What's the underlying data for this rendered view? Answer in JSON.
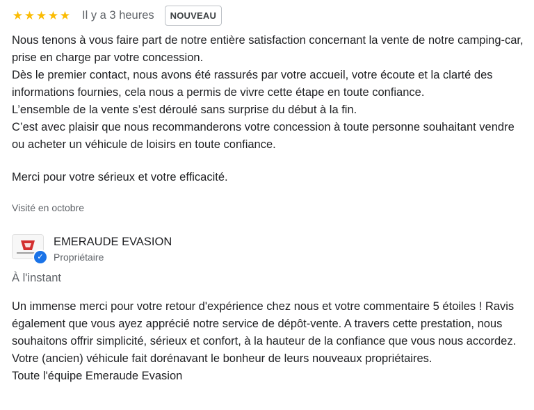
{
  "review": {
    "rating": 5,
    "stars": [
      "★",
      "★",
      "★",
      "★",
      "★"
    ],
    "time_ago": "Il y a 3 heures",
    "badge": "NOUVEAU",
    "lines": [
      "Nous tenons à vous faire part de notre entière satisfaction concernant la vente de notre camping-car, prise en charge par votre concession.",
      "Dès le premier contact, nous avons été rassurés par votre accueil, votre écoute et la clarté des informations fournies, cela nous a permis de vivre cette étape en toute confiance.",
      "L’ensemble de la vente s’est déroulé sans surprise du début à la fin.",
      "C’est avec plaisir que nous recommanderons votre concession à toute personne souhaitant vendre ou acheter un véhicule de loisirs en toute confiance."
    ],
    "thanks": "Merci pour votre sérieux et votre efficacité.",
    "visited": "Visité en octobre"
  },
  "owner": {
    "name": "EMERAUDE EVASION",
    "role": "Propriétaire",
    "avatar_icon": "business-logo-icon",
    "verified_icon": "verified-check-icon",
    "verified_glyph": "✓",
    "reply_time": "À l'instant",
    "reply_text": "Un immense merci pour votre retour d'expérience chez nous et votre commentaire 5 étoiles ! Ravis également que vous ayez apprécié notre service de dépôt-vente. A travers cette prestation, nous souhaitons offrir simplicité, sérieux et confort, à la hauteur de la confiance que vous nous accordez. Votre (ancien) véhicule fait dorénavant le bonheur de leurs nouveaux propriétaires.",
    "signature": "Toute l'équipe Emeraude Evasion"
  },
  "colors": {
    "star": "#fbbc04",
    "verified": "#1a73e8",
    "logo_red": "#d32f2f"
  }
}
